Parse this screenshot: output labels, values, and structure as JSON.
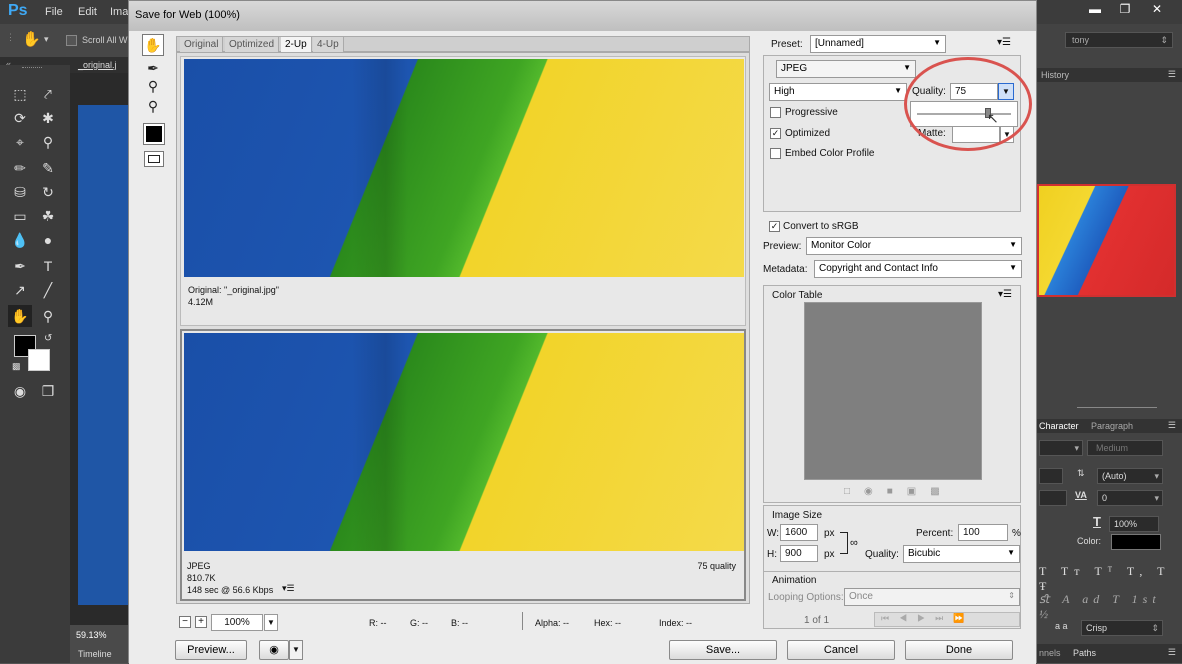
{
  "app": {
    "logo": "Ps",
    "menu": [
      "File",
      "Edit",
      "Ima"
    ],
    "options_label": "Scroll All W",
    "doc_tab": "_original.j",
    "zoom_status": "59.13%",
    "timeline_label": "Timeline"
  },
  "right_panels": {
    "workspace": "tony",
    "history": "History",
    "character_tabs": [
      "Character",
      "Paragraph"
    ],
    "font_style": "Medium",
    "leading": "(Auto)",
    "tracking": "0",
    "scale": "100%",
    "color_label": "Color:",
    "antialias_label": "a a",
    "antialias": "Crisp",
    "panel_tabs": [
      "nnels",
      "Paths"
    ]
  },
  "dialog": {
    "title": "Save for Web (100%)",
    "view_tabs": [
      "Original",
      "Optimized",
      "2-Up",
      "4-Up"
    ],
    "active_tab": "2-Up",
    "original_info": {
      "name": "Original: \"_original.jpg\"",
      "size": "4.12M"
    },
    "optimized_info": {
      "format": "JPEG",
      "size": "810.7K",
      "time": "148 sec @ 56.6 Kbps",
      "quality": "75 quality"
    },
    "bottom": {
      "zoom": "100%",
      "r": "R: --",
      "g": "G: --",
      "b": "B: --",
      "alpha": "Alpha: --",
      "hex": "Hex: --",
      "index": "Index: --"
    },
    "buttons": {
      "preview": "Preview...",
      "save": "Save...",
      "cancel": "Cancel",
      "done": "Done"
    }
  },
  "settings": {
    "preset_label": "Preset:",
    "preset": "[Unnamed]",
    "format": "JPEG",
    "quality_preset": "High",
    "quality_label": "Quality:",
    "quality": "75",
    "quality_slider": 0.75,
    "progressive": {
      "label": "Progressive",
      "checked": false
    },
    "optimized": {
      "label": "Optimized",
      "checked": true
    },
    "embed_profile": {
      "label": "Embed Color Profile",
      "checked": false
    },
    "matte_label": "Matte:",
    "convert_srgb": {
      "label": "Convert to sRGB",
      "checked": true
    },
    "preview_label": "Preview:",
    "preview": "Monitor Color",
    "metadata_label": "Metadata:",
    "metadata": "Copyright and Contact Info",
    "color_table_label": "Color Table",
    "image_size": {
      "label": "Image Size",
      "w_label": "W:",
      "w": "1600",
      "h_label": "H:",
      "h": "900",
      "unit": "px",
      "percent_label": "Percent:",
      "percent": "100",
      "percent_unit": "%",
      "quality_label": "Quality:",
      "quality": "Bicubic"
    },
    "animation": {
      "label": "Animation",
      "looping_label": "Looping Options:",
      "looping": "Once",
      "frame": "1 of 1"
    }
  },
  "colors": {
    "highlight_circle": "#d9534f",
    "photo_blue": "#1d55b0",
    "photo_green": "#3fa523",
    "photo_yellow": "#f2d42a"
  }
}
